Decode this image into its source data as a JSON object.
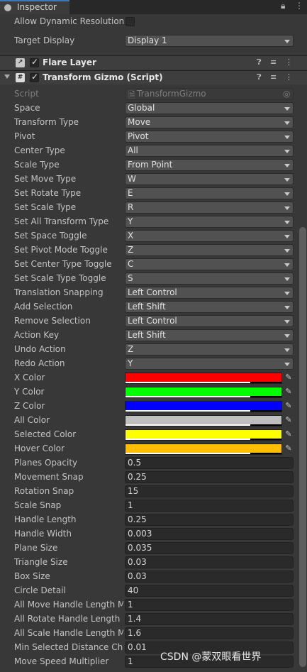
{
  "tab": {
    "title": "Inspector"
  },
  "top_rows": [
    {
      "label": "Allow Dynamic Resolution"
    },
    {
      "label": "Target Display",
      "value": "Display 1"
    }
  ],
  "components": [
    {
      "title": "Flare Layer"
    },
    {
      "title": "Transform Gizmo (Script)"
    }
  ],
  "script_field": {
    "label": "Script",
    "value": "TransformGizmo"
  },
  "dropdowns": [
    {
      "label": "Space",
      "value": "Global"
    },
    {
      "label": "Transform Type",
      "value": "Move"
    },
    {
      "label": "Pivot",
      "value": "Pivot"
    },
    {
      "label": "Center Type",
      "value": "All"
    },
    {
      "label": "Scale Type",
      "value": "From Point"
    },
    {
      "label": "Set Move Type",
      "value": "W"
    },
    {
      "label": "Set Rotate Type",
      "value": "E"
    },
    {
      "label": "Set Scale Type",
      "value": "R"
    },
    {
      "label": "Set All Transform Type",
      "value": "Y"
    },
    {
      "label": "Set Space Toggle",
      "value": "X"
    },
    {
      "label": "Set Pivot Mode Toggle",
      "value": "Z"
    },
    {
      "label": "Set Center Type Toggle",
      "value": "C"
    },
    {
      "label": "Set Scale Type Toggle",
      "value": "S"
    },
    {
      "label": "Translation Snapping",
      "value": "Left Control"
    },
    {
      "label": "Add Selection",
      "value": "Left Shift"
    },
    {
      "label": "Remove Selection",
      "value": "Left Control"
    },
    {
      "label": "Action Key",
      "value": "Left Shift"
    },
    {
      "label": "Undo Action",
      "value": "Z"
    },
    {
      "label": "Redo Action",
      "value": "Y"
    }
  ],
  "colors": [
    {
      "label": "X Color",
      "color": "#ff0000"
    },
    {
      "label": "Y Color",
      "color": "#00ff00"
    },
    {
      "label": "Z Color",
      "color": "#0000ff"
    },
    {
      "label": "All Color",
      "color": "#bfbfbf"
    },
    {
      "label": "Selected Color",
      "color": "#ffff00"
    },
    {
      "label": "Hover Color",
      "color": "#ffbf00"
    }
  ],
  "fields": [
    {
      "label": "Planes Opacity",
      "value": "0.5"
    },
    {
      "label": "Movement Snap",
      "value": "0.25"
    },
    {
      "label": "Rotation Snap",
      "value": "15"
    },
    {
      "label": "Scale Snap",
      "value": "1"
    },
    {
      "label": "Handle Length",
      "value": "0.25"
    },
    {
      "label": "Handle Width",
      "value": "0.003"
    },
    {
      "label": "Plane Size",
      "value": "0.035"
    },
    {
      "label": "Triangle Size",
      "value": "0.03"
    },
    {
      "label": "Box Size",
      "value": "0.03"
    },
    {
      "label": "Circle Detail",
      "value": "40"
    },
    {
      "label": "All Move Handle Length Multiplier",
      "value": "1"
    },
    {
      "label": "All Rotate Handle Length Multiplier",
      "value": "1.4"
    },
    {
      "label": "All Scale Handle Length Multiplier",
      "value": "1.6"
    },
    {
      "label": "Min Selected Distance Check",
      "value": "0.01"
    },
    {
      "label": "Move Speed Multiplier",
      "value": "1"
    }
  ],
  "watermark": "CSDN @蒙双眼看世界"
}
